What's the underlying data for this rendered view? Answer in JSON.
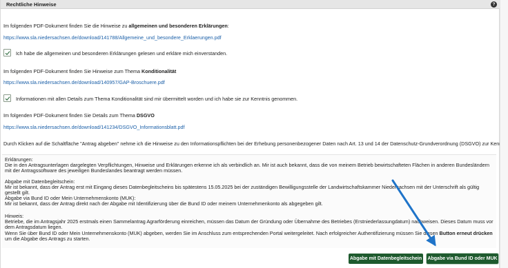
{
  "header": {
    "title": "Rechtliche Hinweise",
    "help_icon": "?"
  },
  "sections": {
    "s1": {
      "text_prefix": "Im folgenden PDF-Dokument finden Sie die Hinweise zu ",
      "text_bold": "allgemeinen und besonderen Erklärungen",
      "text_suffix": ":",
      "link": "https://www.sla.niedersachsen.de/download/141788/Allgemeine_und_besondere_Erklaerungen.pdf",
      "checkbox_label": "Ich habe die allgemeinen und besonderen Erklärungen gelesen und erkläre mich einverstanden."
    },
    "s2": {
      "text_prefix": "Im folgenden PDF-Dokument finden Sie Hinweise zum Thema ",
      "text_bold": "Konditionalität",
      "link": "https://www.sla.niedersachsen.de/download/140957/GAP-Broschuere.pdf",
      "checkbox_label": "Informationen mit allen Details zum Thema Konditionalität sind mir übermittelt worden und ich habe sie zur Kenntnis genommen."
    },
    "s3": {
      "text_prefix": "Im folgenden PDF-Dokument finden Sie Details zum Thema ",
      "text_bold": "DSGVO",
      "link": "https://www.sla.niedersachsen.de/download/141234/DSGVO_Informationsblatt.pdf"
    },
    "dsgvo_note": "Durch Klicken auf die Schaltfläche \"Antrag abgeben\" nehme ich die Hinweise zu den Informationspflichten bei der Erhebung personenbezogener Daten nach Art. 13 und 14 der Datenschutz-Grundverordnung (DSGVO) zur Kenntnis."
  },
  "info": {
    "erklaerungen_title": "Erklärungen:",
    "erklaerungen_body": "Die in den Antragsunterlagen dargelegten Verpflichtungen, Hinweise und Erklärungen erkenne ich als verbindlich an. Mir ist auch bekannt, dass die von meinem Betrieb bewirtschafteten Flächen in anderen Bundesländern mit der Antragssoftware des jeweiligen Bundeslandes beantragt werden müssen.",
    "datenbegleitschein_title": "Abgabe mit Datenbegleitschein:",
    "datenbegleitschein_body": "Mir ist bekannt, dass der Antrag erst mit Eingang dieses Datenbegleitscheins bis spätestens 15.05.2025 bei der zuständigen Bewilligungsstelle der Landwirtschaftskammer Niedersachsen mit der Unterschrift als gültig gestellt gilt.",
    "bundid_title": "Abgabe via Bund ID oder Mein Unternehmenskonto (MUK):",
    "bundid_body": "Mir ist bekannt, dass der Antrag direkt nach der Abgabe mit Identifizierung über die Bund ID oder meinem Unternehmenkonto als abgegeben gilt.",
    "hinweis_title": "Hinweis:",
    "hinweis_body1": "Betriebe, die im Antragsjahr 2025 erstmals einen Sammelantrag Agrarförderung einreichen, müssen das Datum der Gründung oder Übernahme des Betriebes (Erstniederlassungdatum) nachweisen. Dieses Datum muss vor dem Antragsdatum liegen.",
    "hinweis_body2_prefix": "Wenn Sie über Bund ID oder Mein Unternehmenskonto (MUK) abgeben, werden Sie im Anschluss zum entsprechenden Portal weitergeleitet. Nach erfolgreicher Authentifizierung müssen Sie diesen ",
    "hinweis_body2_bold": "Button erneut drücken",
    "hinweis_body2_suffix": " um die Abgabe des Antrags zu starten."
  },
  "buttons": {
    "datenbegleitschein": "Abgabe mit Datenbegleitschein",
    "bundid": "Abgabe via Bund ID oder MUK"
  },
  "colors": {
    "button_green": "#1e5a2e",
    "link_blue": "#1a5fa8",
    "arrow_blue": "#1f74c9"
  }
}
